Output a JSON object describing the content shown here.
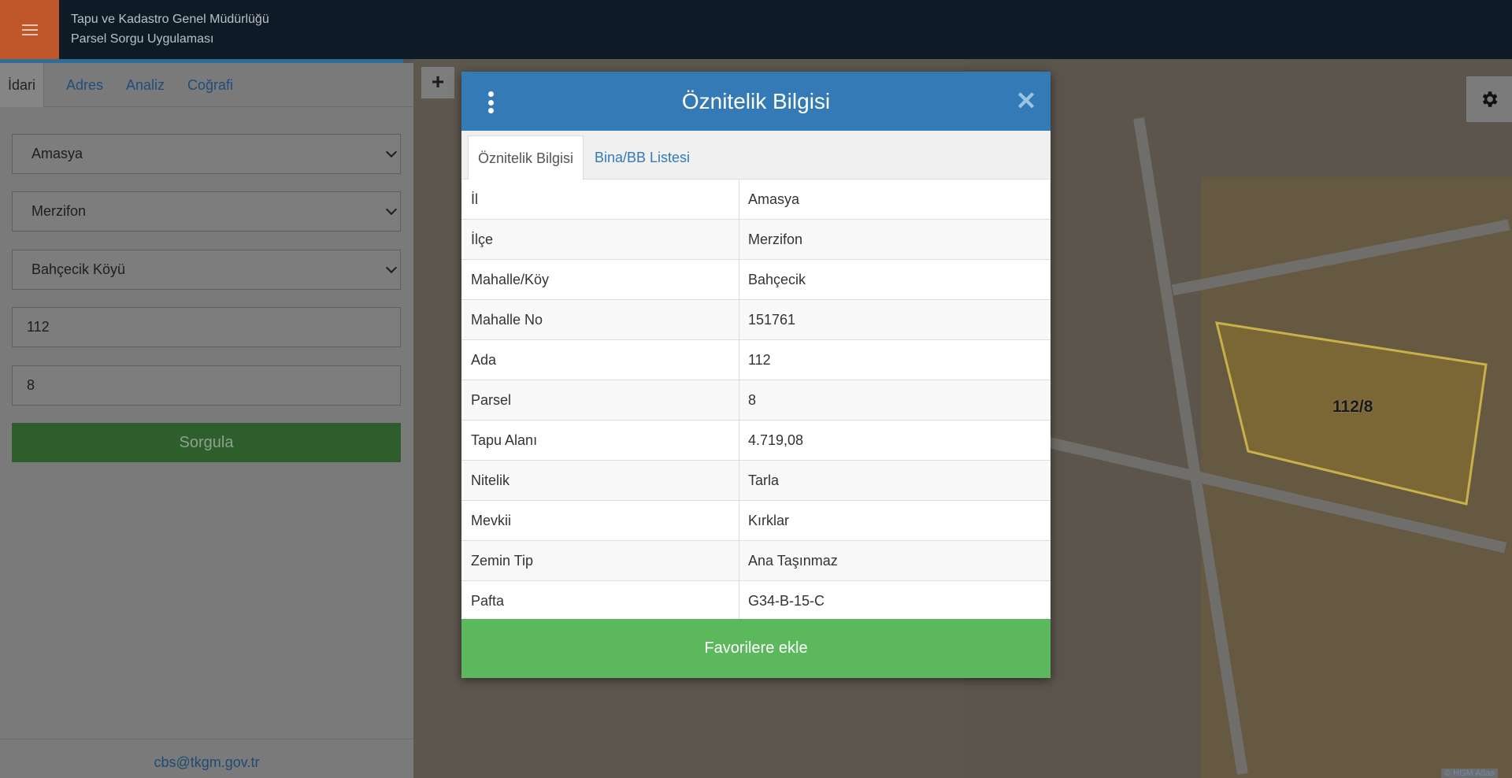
{
  "header": {
    "org_name": "Tapu ve Kadastro Genel Müdürlüğü",
    "app_name": "Parsel Sorgu Uygulaması",
    "menu_icon": "hamburger-icon"
  },
  "left_panel": {
    "tabs": [
      {
        "label": "İdari",
        "active": true
      },
      {
        "label": "Adres",
        "active": false
      },
      {
        "label": "Analiz",
        "active": false
      },
      {
        "label": "Coğrafi",
        "active": false
      }
    ],
    "il_select": "Amasya",
    "ilce_select": "Merzifon",
    "mahalle_select": "Bahçecik Köyü",
    "ada_input": "112",
    "parsel_input": "8",
    "query_button": "Sorgula",
    "footer_email": "cbs@tkgm.gov.tr"
  },
  "map": {
    "zoom_in_label": "+",
    "parcel_label": "112/8",
    "attribution": "© HGM Atlas",
    "settings_icon": "gear-icon"
  },
  "modal": {
    "title": "Öznitelik Bilgisi",
    "close_label": "✕",
    "tabs": [
      {
        "label": "Öznitelik Bilgisi",
        "active": true
      },
      {
        "label": "Bina/BB Listesi",
        "active": false
      }
    ],
    "rows": [
      {
        "key": "İl",
        "value": "Amasya"
      },
      {
        "key": "İlçe",
        "value": "Merzifon"
      },
      {
        "key": "Mahalle/Köy",
        "value": "Bahçecik"
      },
      {
        "key": "Mahalle No",
        "value": "151761"
      },
      {
        "key": "Ada",
        "value": "112"
      },
      {
        "key": "Parsel",
        "value": "8"
      },
      {
        "key": "Tapu Alanı",
        "value": "4.719,08"
      },
      {
        "key": "Nitelik",
        "value": "Tarla"
      },
      {
        "key": "Mevkii",
        "value": "Kırklar"
      },
      {
        "key": "Zemin Tip",
        "value": "Ana Taşınmaz"
      },
      {
        "key": "Pafta",
        "value": "G34-B-15-C"
      }
    ],
    "favorite_button": "Favorilere ekle"
  },
  "colors": {
    "header_bg": "#0e1a26",
    "menu_accent": "#c0572a",
    "modal_header": "#337ab7",
    "success_green": "#5cb85c"
  }
}
